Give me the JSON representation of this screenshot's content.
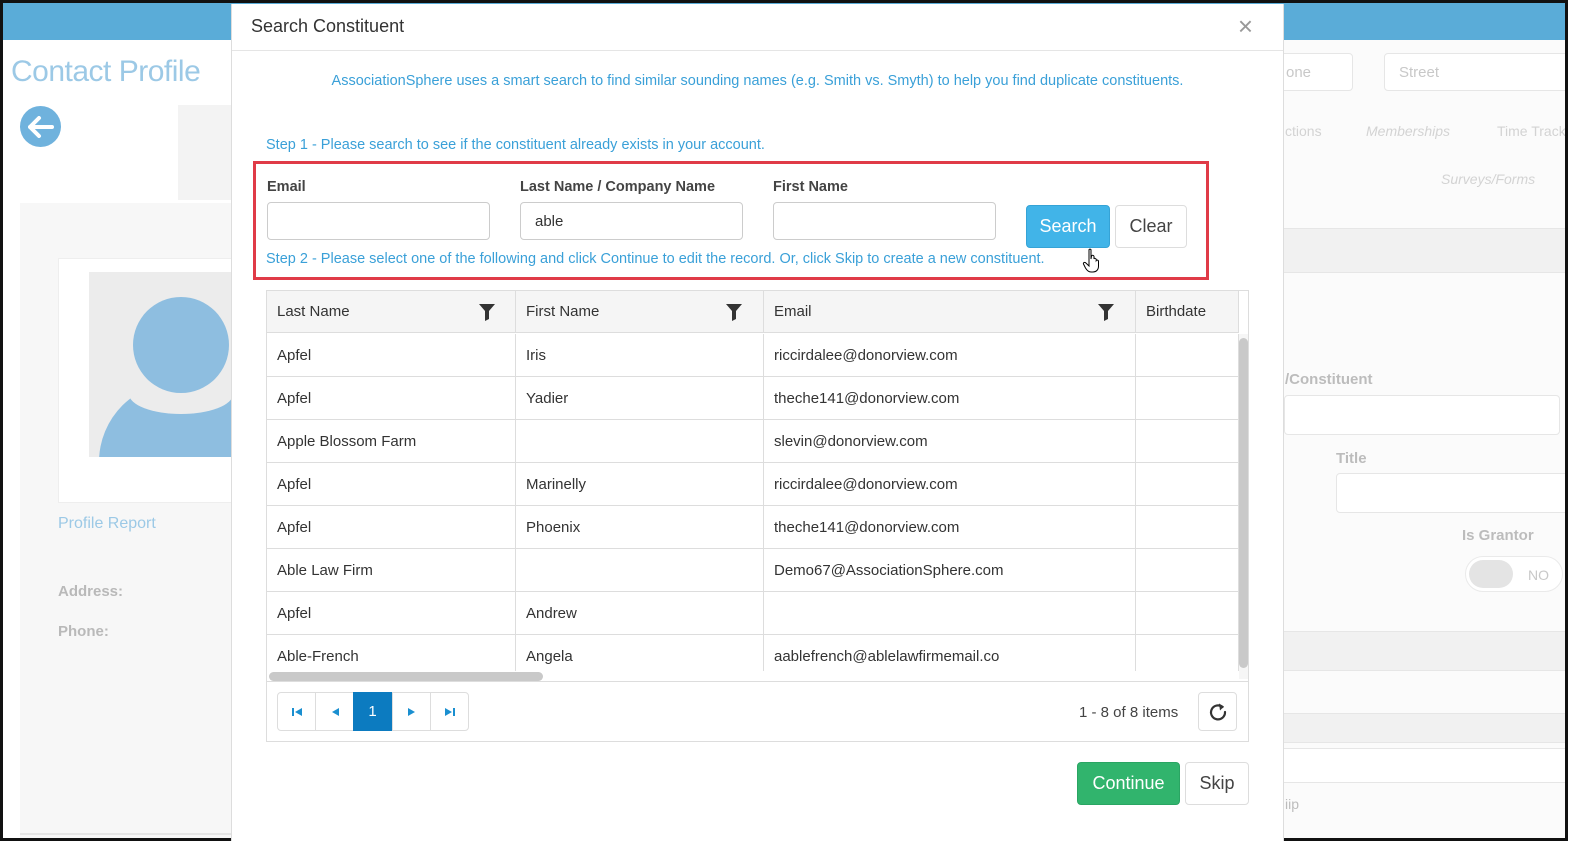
{
  "background": {
    "page_title": "Contact Profile",
    "profile_report_link": "Profile Report",
    "address_label": "Address:",
    "phone_label": "Phone:",
    "right": {
      "phone_placeholder_fragment": "one",
      "street_placeholder": "Street",
      "tabs": [
        "ctions",
        "Memberships",
        "Time Track",
        "Surveys/Forms"
      ],
      "constituent_label_fragment": "/Constituent",
      "title_label": "Title",
      "is_grantor_label": "Is Grantor",
      "is_grantor_value": "NO",
      "bottom_fragment": "iip"
    }
  },
  "modal": {
    "title": "Search Constituent",
    "close_symbol": "×",
    "intro": "AssociationSphere uses a smart search to find similar sounding names (e.g. Smith vs. Smyth) to help you find duplicate constituents.",
    "step1": "Step 1 - Please search to see if the constituent already exists in your account.",
    "step2": "Step 2 - Please select one of the following and click Continue to edit the record. Or, click Skip to create a new constituent.",
    "form": {
      "email_label": "Email",
      "email_value": "",
      "last_name_label": "Last Name / Company Name",
      "last_name_value": "able",
      "first_name_label": "First Name",
      "first_name_value": "",
      "search_button": "Search",
      "clear_button": "Clear"
    },
    "grid": {
      "columns": [
        "Last Name",
        "First Name",
        "Email",
        "Birthdate"
      ],
      "rows": [
        [
          "Apfel",
          "Iris",
          "riccirdalee@donorview.com",
          ""
        ],
        [
          "Apfel",
          "Yadier",
          "theche141@donorview.com",
          ""
        ],
        [
          "Apple Blossom Farm",
          "",
          "slevin@donorview.com",
          ""
        ],
        [
          "Apfel",
          "Marinelly",
          "riccirdalee@donorview.com",
          ""
        ],
        [
          "Apfel",
          "Phoenix",
          "theche141@donorview.com",
          ""
        ],
        [
          "Able Law Firm",
          "",
          "Demo67@AssociationSphere.com",
          ""
        ],
        [
          "Apfel",
          "Andrew",
          "",
          ""
        ],
        [
          "Able-French",
          "Angela",
          "aablefrench@ablelawfirmemail.co",
          ""
        ]
      ],
      "pager": {
        "current_page": "1",
        "info": "1 - 8 of 8 items"
      }
    },
    "continue_button": "Continue",
    "skip_button": "Skip"
  },
  "colors": {
    "accent_blue": "#41b4e8",
    "link_blue": "#3aa0d8",
    "highlight_red": "#e03b47",
    "continue_green": "#31b46d",
    "pager_active": "#0c7bc0"
  }
}
